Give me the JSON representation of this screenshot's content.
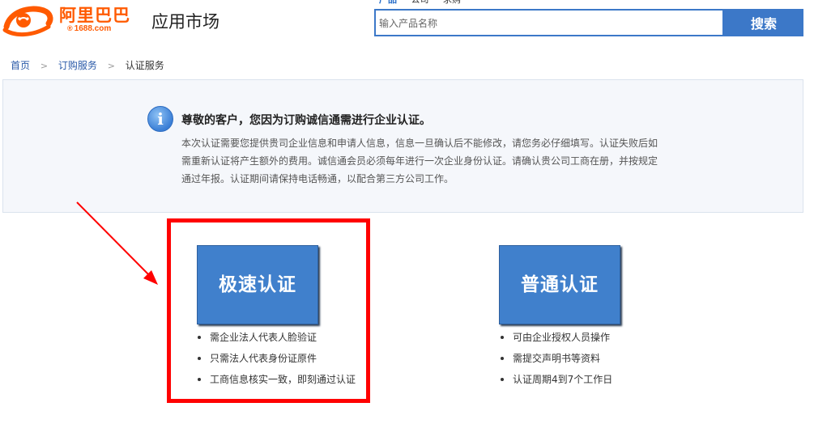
{
  "header": {
    "logo": {
      "name": "阿里巴巴",
      "sub": "1688.com",
      "reg": "®"
    },
    "title": "应用市场"
  },
  "search": {
    "tabs": [
      "产品",
      "公司",
      "求购"
    ],
    "placeholder": "输入产品名称",
    "button_label": "搜索"
  },
  "breadcrumb": {
    "items": [
      {
        "label": "首页"
      },
      {
        "label": "订购服务"
      },
      {
        "label": "认证服务"
      }
    ]
  },
  "notice": {
    "icon_char": "i",
    "title": "尊敬的客户，您因为订购诚信通需进行企业认证。",
    "lines": [
      "本次认证需要您提供贵司企业信息和申请人信息，信息一旦确认后不能修改，请您务必仔细填写。认证失败后如",
      "需重新认证将产生额外的费用。诚信通会员必须每年进行一次企业身份认证。请确认贵公司工商在册，并按规定",
      "通过年报。认证期间请保持电话畅通，以配合第三方公司工作。"
    ]
  },
  "options": {
    "fast": {
      "label": "极速认证",
      "features": [
        "需企业法人代表人脸验证",
        "只需法人代表身份证原件",
        "工商信息核实一致，即刻通过认证"
      ]
    },
    "normal": {
      "label": "普通认证",
      "features": [
        "可由企业授权人员操作",
        "需提交声明书等资料",
        "认证周期4到7个工作日"
      ]
    }
  },
  "colors": {
    "brand_orange": "#ff5a00",
    "search_blue": "#3c78c8",
    "button_blue": "#4080cc",
    "highlight_red": "#ff0000",
    "link_blue": "#2a5aa8"
  }
}
